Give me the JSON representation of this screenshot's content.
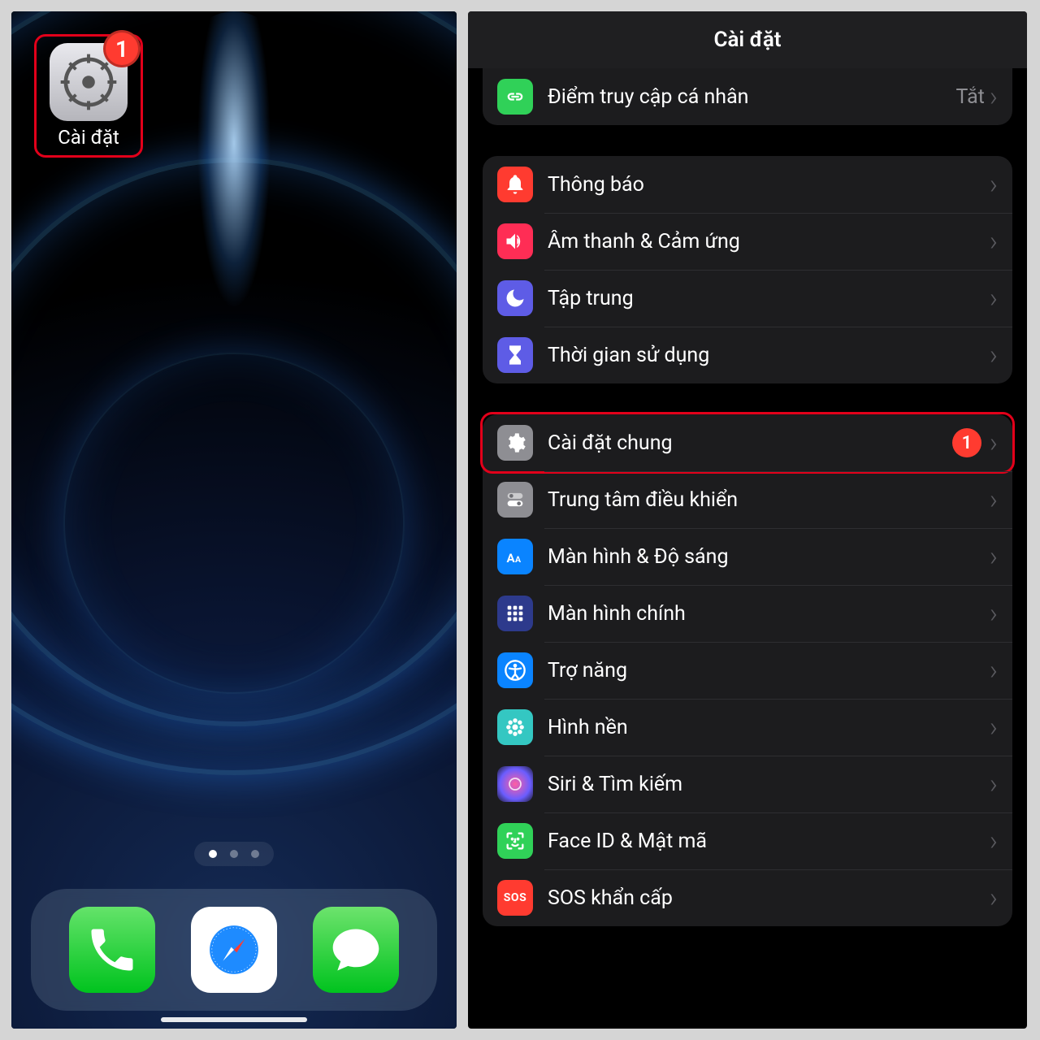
{
  "left": {
    "settings_icon_label": "Cài đặt",
    "settings_badge": "1",
    "page_indicator": {
      "count": 3,
      "active": 0
    }
  },
  "right": {
    "header_title": "Cài đặt",
    "group0": {
      "hotspot_label": "Điểm truy cập cá nhân",
      "hotspot_value": "Tắt"
    },
    "group1": {
      "notifications": "Thông báo",
      "sounds": "Âm thanh & Cảm ứng",
      "focus": "Tập trung",
      "screentime": "Thời gian sử dụng"
    },
    "group2": {
      "general": "Cài đặt chung",
      "general_badge": "1",
      "control_center": "Trung tâm điều khiển",
      "display": "Màn hình & Độ sáng",
      "home": "Màn hình chính",
      "accessibility": "Trợ năng",
      "wallpaper": "Hình nền",
      "siri": "Siri & Tìm kiếm",
      "faceid": "Face ID & Mật mã",
      "sos": "SOS khẩn cấp"
    }
  }
}
